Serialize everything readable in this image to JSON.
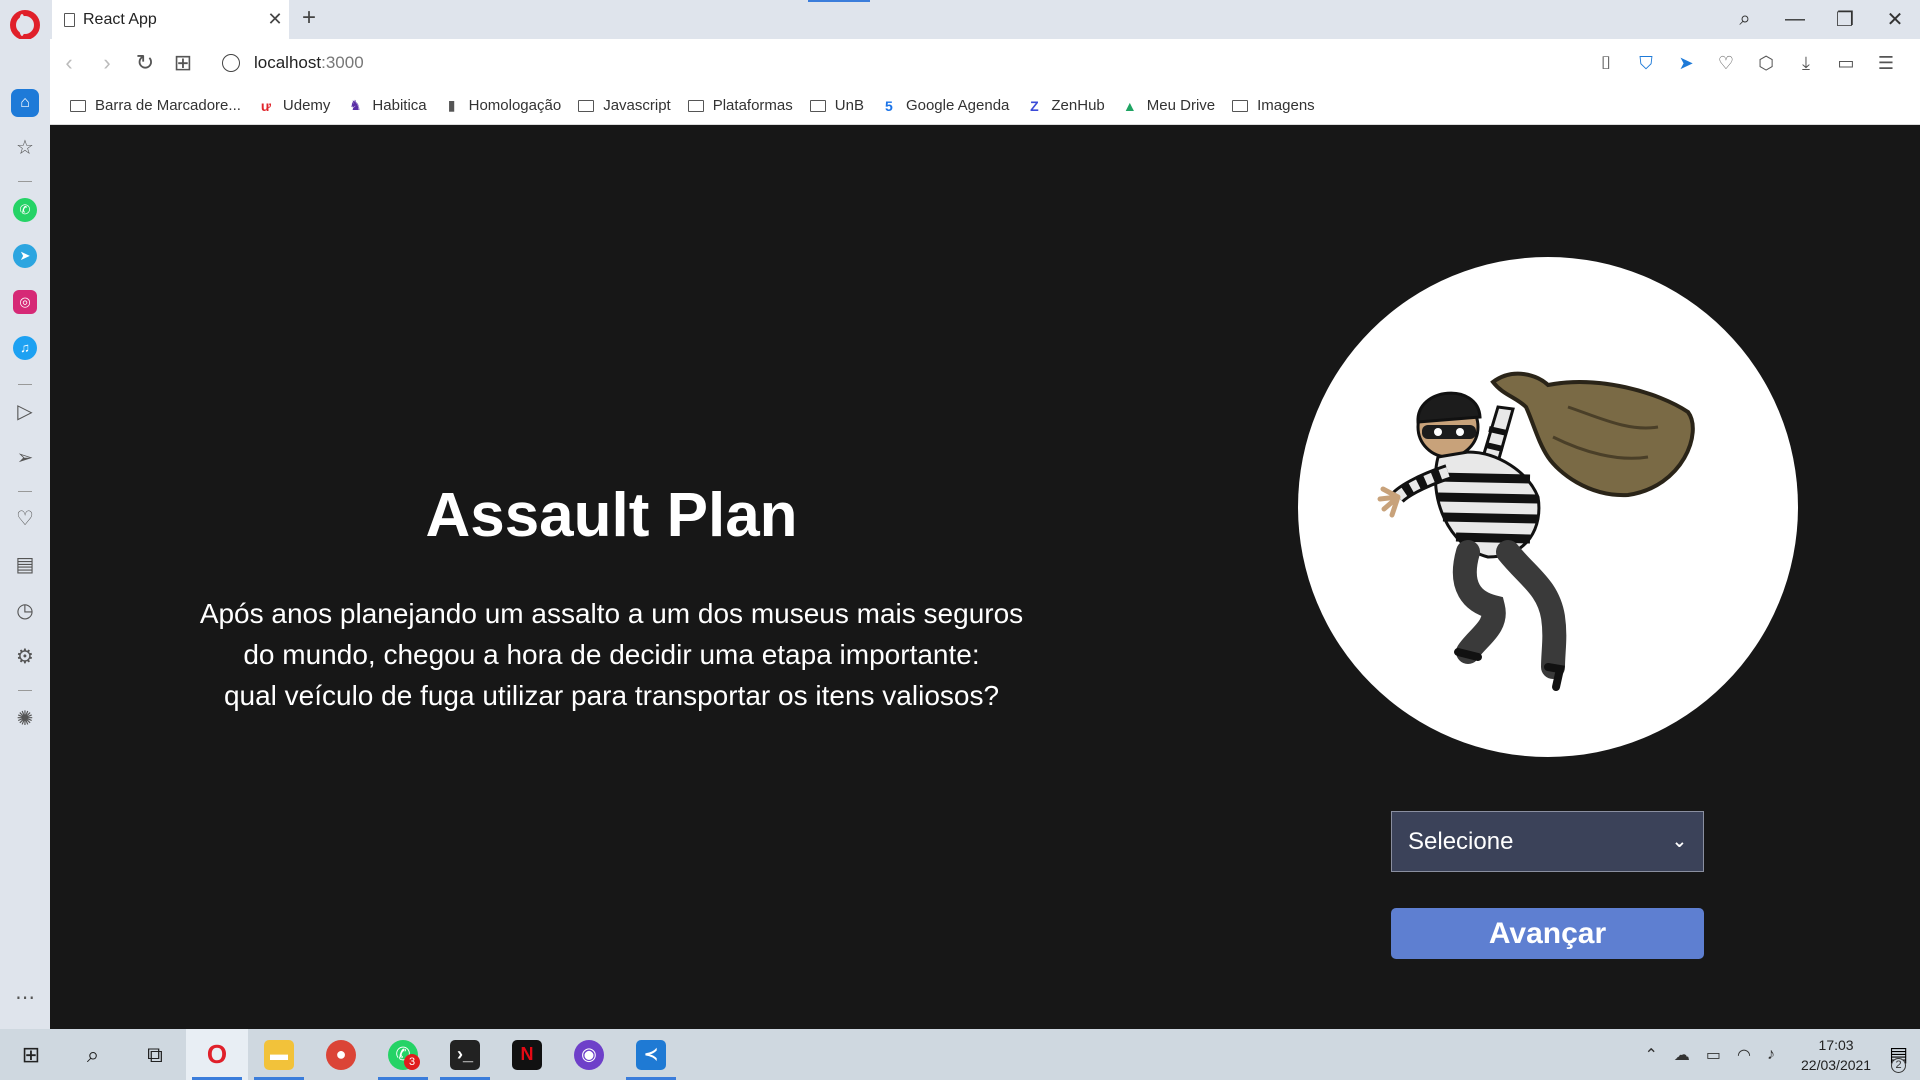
{
  "browser": {
    "tab": {
      "title": "React App",
      "close": "✕"
    },
    "new_tab": "+",
    "window_controls": {
      "search": "⌕",
      "minimize": "—",
      "restore": "❐",
      "close": "✕"
    },
    "address": {
      "host": "localhost",
      "port": ":3000"
    },
    "bookmarks": [
      {
        "label": "Barra de Marcadore...",
        "icon": "folder-icon"
      },
      {
        "label": "Udemy",
        "icon": "udemy-icon",
        "glyph": "ư",
        "color": "#e0262d"
      },
      {
        "label": "Habitica",
        "icon": "habitica-icon",
        "glyph": "♞",
        "color": "#5a2ea6"
      },
      {
        "label": "Homologação",
        "icon": "document-icon",
        "glyph": "▮",
        "color": "#555555"
      },
      {
        "label": "Javascript",
        "icon": "folder-icon"
      },
      {
        "label": "Plataformas",
        "icon": "folder-icon"
      },
      {
        "label": "UnB",
        "icon": "folder-icon"
      },
      {
        "label": "Google Agenda",
        "icon": "calendar-icon",
        "glyph": "5",
        "color": "#1a73e8"
      },
      {
        "label": "ZenHub",
        "icon": "zenhub-icon",
        "glyph": "Z",
        "color": "#3b4bd8"
      },
      {
        "label": "Meu Drive",
        "icon": "drive-icon",
        "glyph": "▲",
        "color": "#1fa463"
      },
      {
        "label": "Imagens",
        "icon": "folder-icon"
      }
    ]
  },
  "page": {
    "title": "Assault Plan",
    "description_lines": [
      "Após anos planejando um assalto a um dos museus mais seguros",
      "do mundo, chegou a hora de decidir uma etapa importante:",
      "qual veículo de fuga utilizar para transportar os itens valiosos?"
    ],
    "select": {
      "label": "Selecione"
    },
    "advance_button": "Avançar"
  },
  "taskbar": {
    "time": "17:03",
    "date": "22/03/2021",
    "whatsapp_badge": "3",
    "notifications_count": "2"
  },
  "colors": {
    "background": "#171717",
    "select_bg": "#3b4259",
    "button_bg": "#5e7fd1",
    "accent": "#1e7ad8"
  }
}
